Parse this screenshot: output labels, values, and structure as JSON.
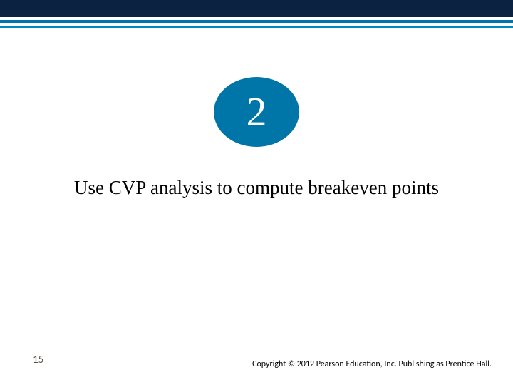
{
  "header": {
    "badge_number": "2"
  },
  "main": {
    "heading": "Use CVP analysis to compute breakeven points"
  },
  "footer": {
    "page_number": "15",
    "copyright": "Copyright © 2012 Pearson Education, Inc. Publishing as Prentice Hall."
  }
}
